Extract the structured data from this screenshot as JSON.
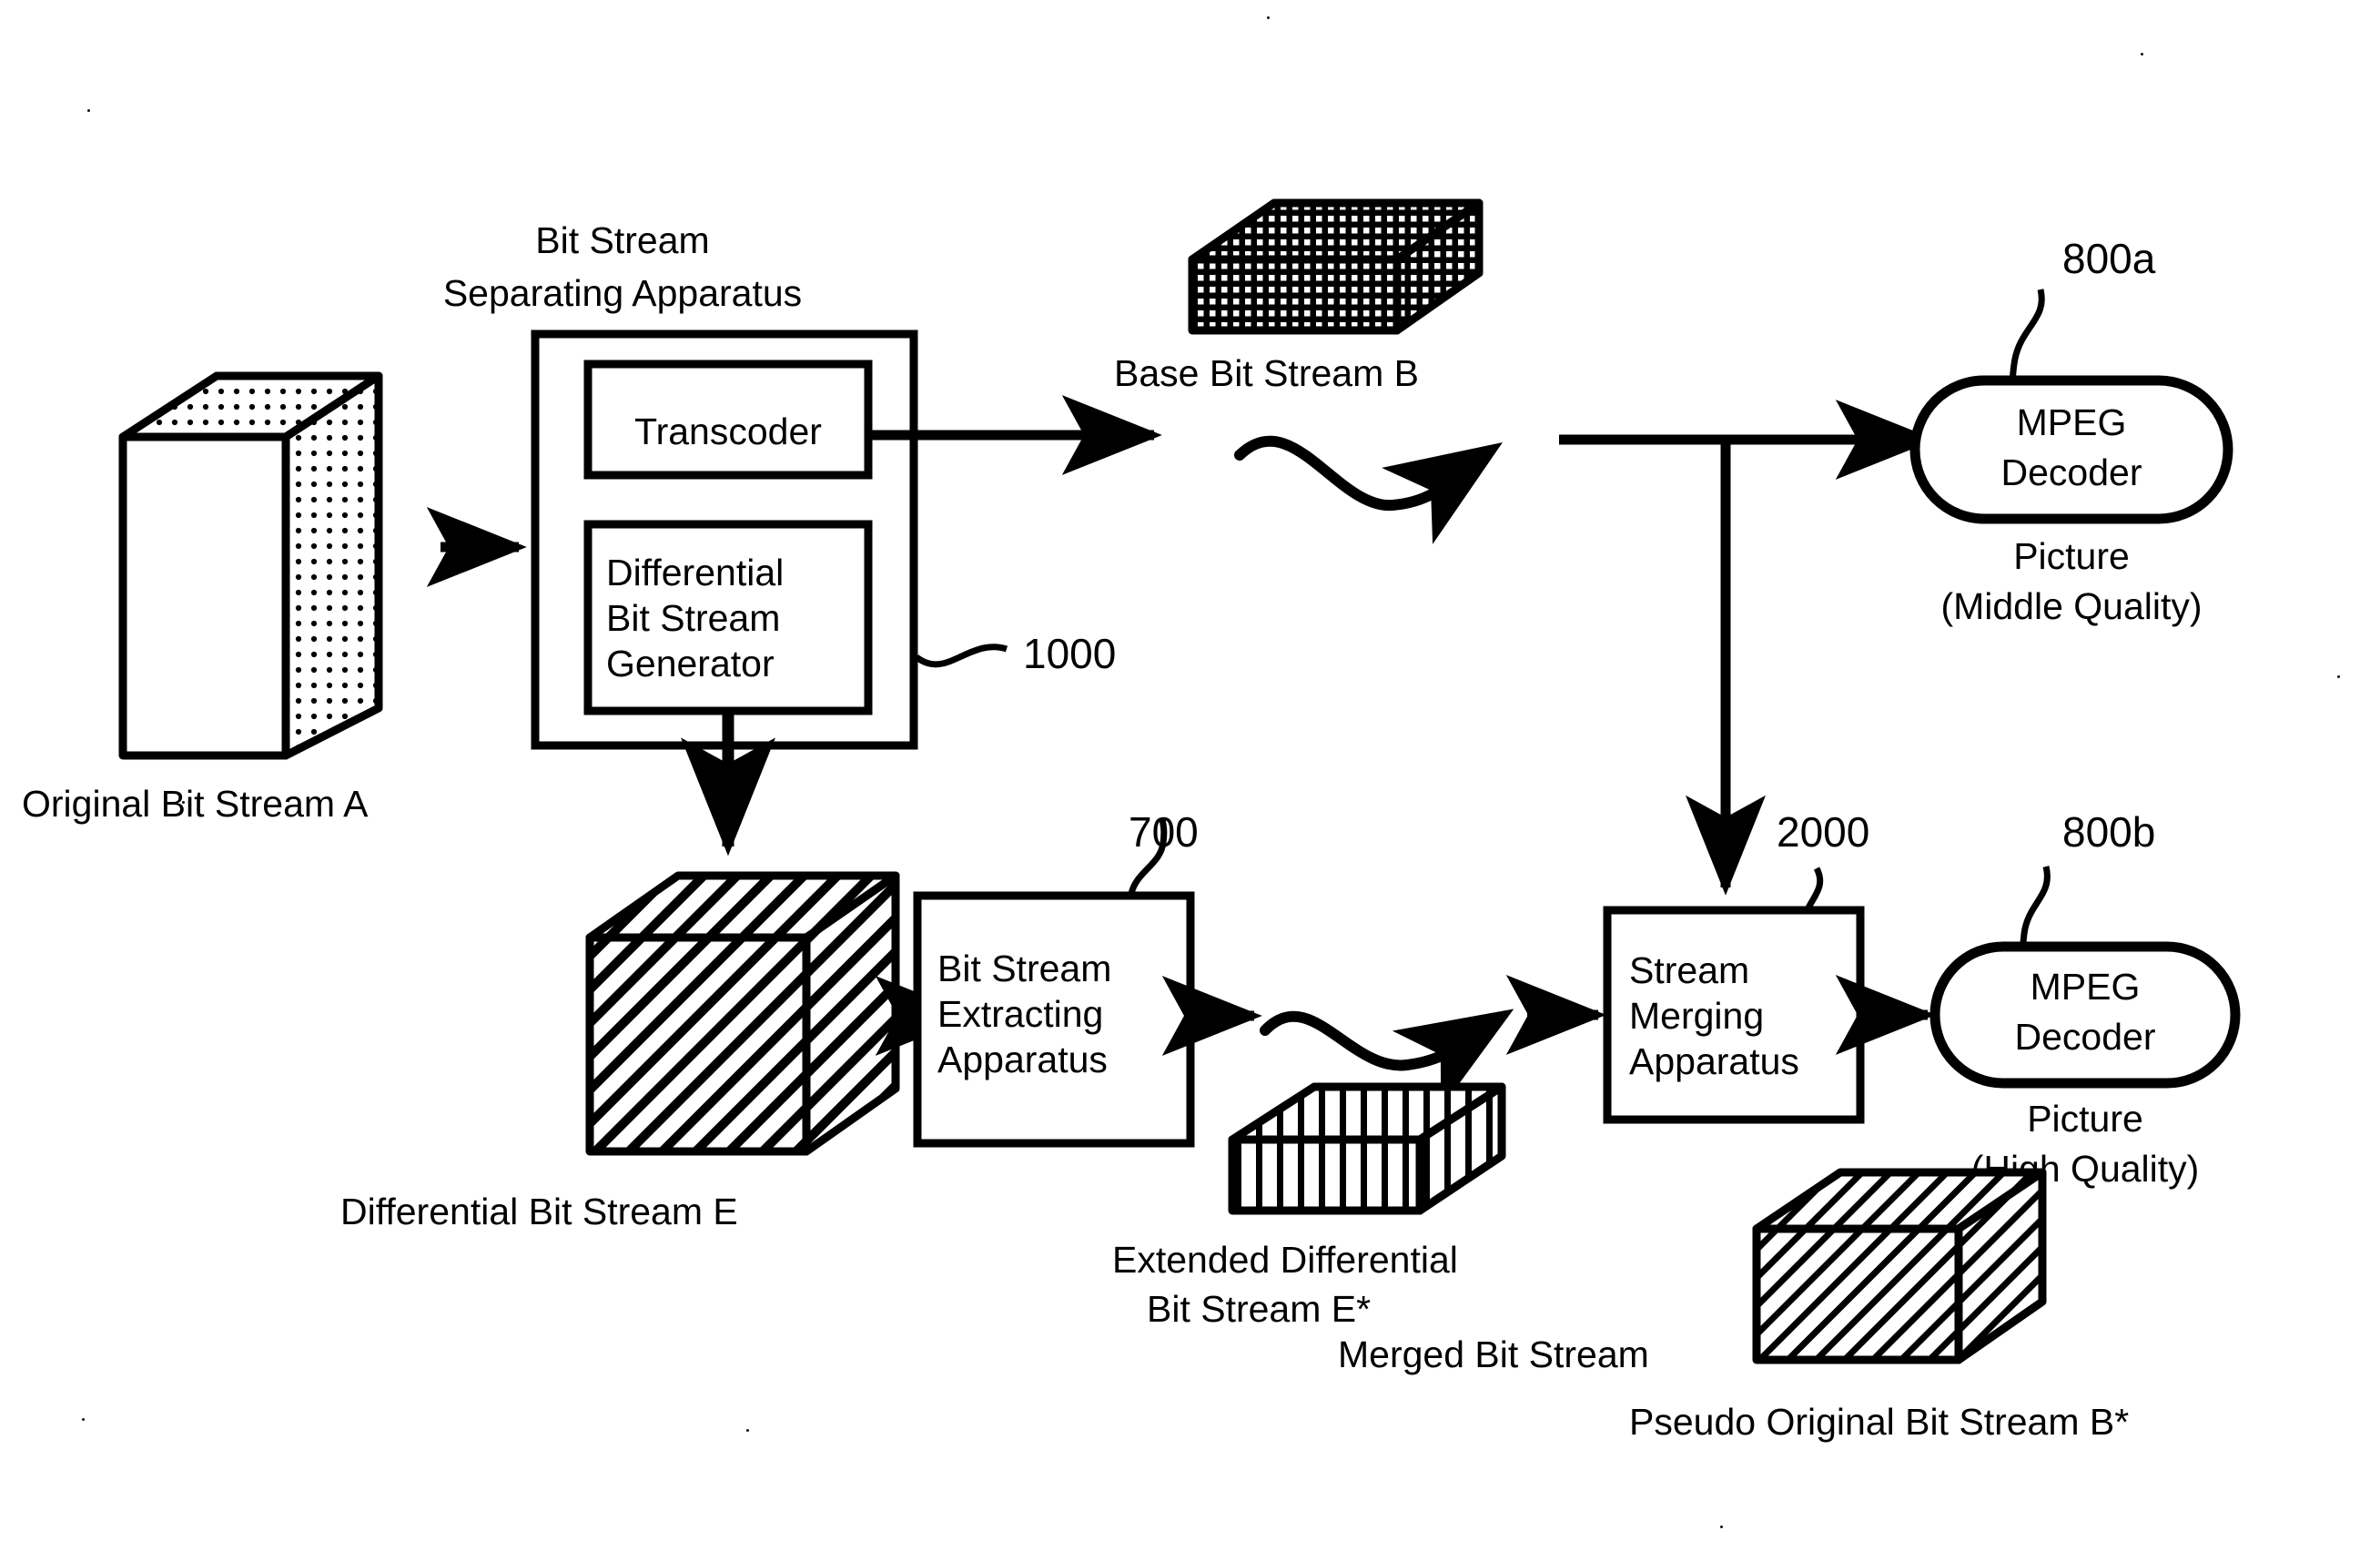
{
  "figure": {
    "type": "patent-block-diagram",
    "background": "#ffffff",
    "ink": "#000000"
  },
  "boxes": {
    "separating_apparatus": {
      "title_line1": "Bit Stream",
      "title_line2": "Separating Apparatus",
      "ref": "1000",
      "children": {
        "transcoder": "Transcoder",
        "diff_gen_line1": "Differential",
        "diff_gen_line2": "Bit Stream",
        "diff_gen_line3": "Generator"
      }
    },
    "extracting_apparatus": {
      "line1": "Bit Stream",
      "line2": "Extracting",
      "line3": "Apparatus",
      "ref": "700"
    },
    "merging_apparatus": {
      "line1": "Stream",
      "line2": "Merging",
      "line3": "Apparatus",
      "ref": "2000"
    },
    "decoder_top": {
      "line1": "MPEG",
      "line2": "Decoder",
      "ref": "800a",
      "caption_line1": "Picture",
      "caption_line2": "(Middle Quality)"
    },
    "decoder_bottom": {
      "line1": "MPEG",
      "line2": "Decoder",
      "ref": "800b",
      "caption_line1": "Picture",
      "caption_line2": "(High Quality)"
    }
  },
  "solids": {
    "original_stream": {
      "label": "Original Bit Stream A",
      "fill": "dotted",
      "shape": "tall-cube"
    },
    "base_stream": {
      "label": "Base Bit Stream B",
      "fill": "grid-dense",
      "shape": "flat-slab"
    },
    "differential_stream": {
      "label": "Differential Bit Stream E",
      "fill": "diagonal-hatch",
      "shape": "cube"
    },
    "extended_differential_stream": {
      "label_line1": "Extended Differential",
      "label_line2": "Bit Stream E*",
      "fill": "vertical-stripe",
      "shape": "flat-slab"
    },
    "merged_stream": {
      "label_line1": "Merged Bit Stream",
      "label_line2": "Pseudo Original Bit Stream B*",
      "fill": "diagonal-hatch",
      "shape": "cube"
    }
  },
  "connectors": {
    "a_to_separator": "arrow-right",
    "transcoder_to_base": "arrow-right",
    "base_wave_to_bus": "wavy-arrow-right",
    "bus_to_decoder_top": "arrow-right",
    "bus_branch_down": "arrow-down",
    "diffgen_to_e": "arrow-down",
    "e_to_extractor": "arrow-right",
    "extractor_to_wave": "arrow-right",
    "estar_wave_to_merger": "wavy-arrow-right",
    "merger_to_decoder_bottom": "arrow-right"
  }
}
